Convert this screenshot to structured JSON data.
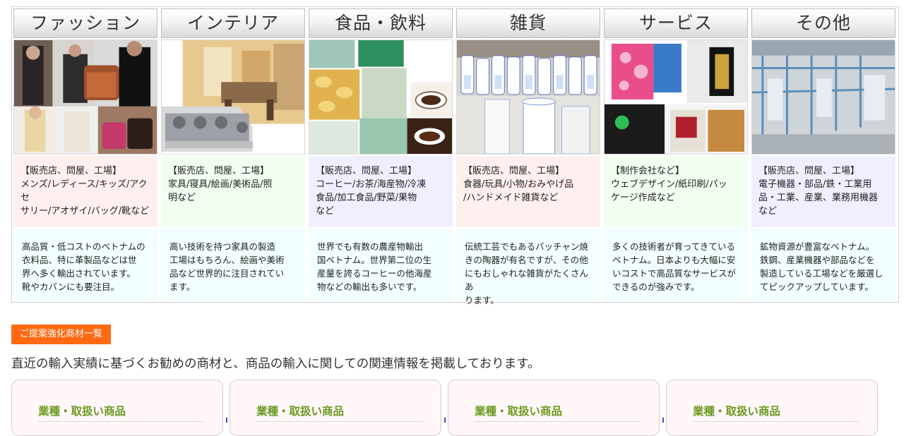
{
  "categories": [
    {
      "title": "ファッション",
      "type_lines": [
        "【販売店、問屋、工場】",
        "メンズ/レディース/キッズ/アクセ",
        "サリー/アオザイ/バッグ/靴など"
      ],
      "desc_lines": [
        "高品質・低コストのベトナムの",
        "衣料品、特に革製品などは世",
        "界へ多く輸出されています。",
        "靴やカバンにも要注目。"
      ],
      "cat_bg": "#fff0ef",
      "image_name": "fashion-photo"
    },
    {
      "title": "インテリア",
      "type_lines": [
        "【販売店、問屋、工場】",
        "家具/寝具/絵画/美術品/照",
        "明など"
      ],
      "desc_lines": [
        "高い技術を持つ家具の製造",
        "工場はもちろん、絵画や美術",
        "品など世界的に注目されてい",
        "ます。"
      ],
      "cat_bg": "#f1fff0",
      "image_name": "interior-photo"
    },
    {
      "title": "食品・飲料",
      "type_lines": [
        "【販売店、問屋、工場】",
        "コーヒー/お茶/海産物/冷凍",
        "食品/加工食品/野菜/果物",
        "など"
      ],
      "desc_lines": [
        "世界でも有数の農産物輸出",
        "国ベトナム。世界第二位の生",
        "産量を誇るコーヒーの他海産",
        "物などの輸出も多いです。"
      ],
      "cat_bg": "#f0efff",
      "image_name": "food-photo"
    },
    {
      "title": "雑貨",
      "type_lines": [
        "【販売店、問屋、工場】",
        "食器/玩具/小物/おみやげ品",
        "/ハンドメイド雑貨など"
      ],
      "desc_lines": [
        "伝統工芸でもあるバッチャン焼",
        "きの陶器が有名ですが、その他",
        "にもおしゃれな雑貨がたくさんあ",
        "ります。"
      ],
      "cat_bg": "#fff0ef",
      "image_name": "goods-photo"
    },
    {
      "title": "サービス",
      "type_lines": [
        "【制作会社など】",
        "ウェブデザイン/紙印刷/パッ",
        "ケージ作成など"
      ],
      "desc_lines": [
        "多くの技術者が育ってきている",
        "ベトナム。日本よりも大幅に安",
        "いコストで高品質なサービスが",
        "できるのが強みです。"
      ],
      "cat_bg": "#f1fff0",
      "image_name": "service-photo"
    },
    {
      "title": "その他",
      "type_lines": [
        "【販売店、問屋、工場】",
        "電子機器・部品/鉄・工業用",
        "品・工業、産業、業務用機器",
        "など"
      ],
      "desc_lines": [
        "鉱物資源が豊富なベトナム。",
        "鉄鋼、産業機器や部品などを",
        "製造している工場などを厳選し",
        "てピックアップしています。"
      ],
      "cat_bg": "#f0efff",
      "image_name": "other-photo"
    }
  ],
  "section_pill": "ご提案強化商材一覧",
  "lead_text": "直近の輸入実績に基づくお勧めの商材と、商品の輸入に関しての関連情報を掲載しております。",
  "cards": [
    {
      "title": "業種・取扱い商品"
    },
    {
      "title": "業種・取扱い商品"
    },
    {
      "title": "業種・取扱い商品"
    },
    {
      "title": "業種・取扱い商品"
    }
  ],
  "colors": {
    "accent_orange": "#ff6a13",
    "card_title_green": "#6a9a1f",
    "desc_bg": "#f1fffe"
  }
}
